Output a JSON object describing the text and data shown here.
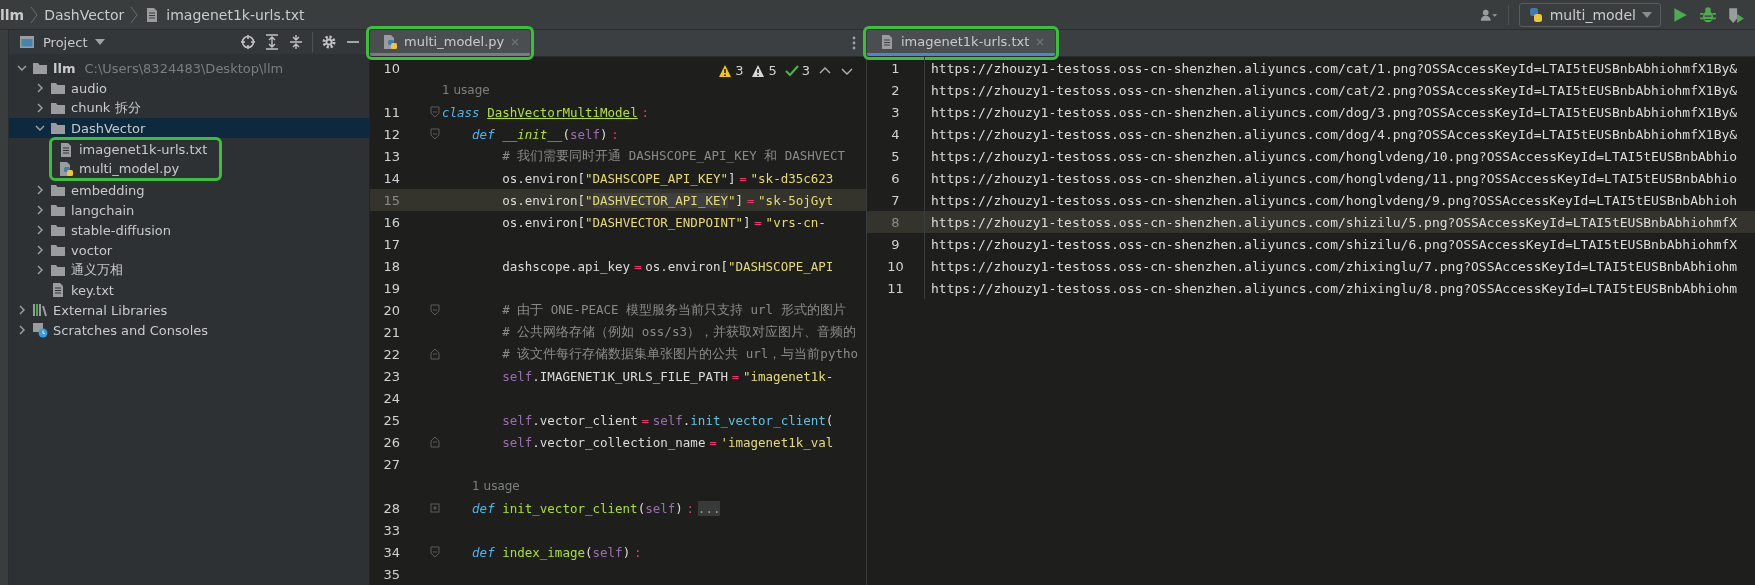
{
  "breadcrumbs": [
    {
      "label": "llm",
      "kind": "project"
    },
    {
      "label": "DashVector",
      "kind": "folder"
    },
    {
      "label": "imagenet1k-urls.txt",
      "kind": "text-file"
    }
  ],
  "toolbar": {
    "run_config": "multi_model"
  },
  "project_panel": {
    "title": "Project",
    "tree": [
      {
        "label": "llm",
        "kind": "project",
        "path": "C:\\Users\\8324483\\Desktop\\llm",
        "expanded": true,
        "selected": false,
        "children": [
          {
            "label": "audio",
            "kind": "folder",
            "expanded": false,
            "selected": false
          },
          {
            "label": "chunk 拆分",
            "kind": "folder",
            "expanded": false,
            "selected": false
          },
          {
            "label": "DashVector",
            "kind": "folder",
            "expanded": true,
            "selected": true,
            "children_annotated": true,
            "children": [
              {
                "label": "imagenet1k-urls.txt",
                "kind": "text-file",
                "selected": false
              },
              {
                "label": "multi_model.py",
                "kind": "python-file",
                "selected": false
              }
            ]
          },
          {
            "label": "embedding",
            "kind": "folder",
            "expanded": false,
            "selected": false
          },
          {
            "label": "langchain",
            "kind": "folder",
            "expanded": false,
            "selected": false
          },
          {
            "label": "stable-diffusion",
            "kind": "folder",
            "expanded": false,
            "selected": false
          },
          {
            "label": "voctor",
            "kind": "folder",
            "expanded": false,
            "selected": false
          },
          {
            "label": "通义万相",
            "kind": "folder",
            "expanded": false,
            "selected": false
          },
          {
            "label": "key.txt",
            "kind": "text-file",
            "selected": false
          }
        ]
      },
      {
        "label": "External Libraries",
        "kind": "libraries",
        "expanded": false,
        "selected": false
      },
      {
        "label": "Scratches and Consoles",
        "kind": "scratches",
        "expanded": false,
        "selected": false
      }
    ]
  },
  "code_editor": {
    "tab": {
      "label": "multi_model.py",
      "kind": "python-file",
      "focused": false,
      "annotated": true
    },
    "inspections": [
      {
        "kind": "warning",
        "count": "3"
      },
      {
        "kind": "weak-warning",
        "count": "5"
      },
      {
        "kind": "typo",
        "count": "3"
      }
    ],
    "lines": [
      {
        "kind": "code",
        "number": "10",
        "current": false
      },
      {
        "kind": "hint",
        "text": "1 usage"
      },
      {
        "kind": "code",
        "number": "11",
        "current": false,
        "collapsed": false,
        "tokens": [
          {
            "kind": "keyword",
            "text": "class"
          },
          {
            "kind": "classname",
            "text": "DashVectorMultiModel"
          },
          {
            "kind": "op",
            "text": ":"
          }
        ],
        "children": [
          {
            "kind": "code",
            "number": "12",
            "current": false,
            "collapsed": false,
            "tokens": [
              {
                "kind": "keyword",
                "text": "def"
              },
              {
                "kind": "magic",
                "text": "__init__"
              },
              {
                "kind": "plain",
                "text": "("
              },
              {
                "kind": "self",
                "text": "self"
              },
              {
                "kind": "plain",
                "text": ")"
              },
              {
                "kind": "op",
                "text": ":"
              }
            ],
            "children": [
              {
                "kind": "code",
                "number": "13",
                "current": false,
                "tokens": [
                  {
                    "kind": "comment",
                    "text": "# 我们需要同时开通 DASHSCOPE_API_KEY 和 DASHVECT"
                  }
                ]
              },
              {
                "kind": "code",
                "number": "14",
                "current": false,
                "tokens": [
                  {
                    "kind": "plain",
                    "text": "os.environ["
                  },
                  {
                    "kind": "string",
                    "text": "\"DASHSCOPE_API_KEY\""
                  },
                  {
                    "kind": "plain",
                    "text": "]"
                  },
                  {
                    "kind": "op",
                    "text": "="
                  },
                  {
                    "kind": "string",
                    "text": "\"sk-d35c623"
                  }
                ]
              },
              {
                "kind": "code",
                "number": "15",
                "current": true,
                "tokens": [
                  {
                    "kind": "plain",
                    "text": "os.environ["
                  },
                  {
                    "kind": "string",
                    "text": "\""
                  },
                  {
                    "kind": "match",
                    "text": "DASHVECTOR_API_KEY"
                  },
                  {
                    "kind": "string",
                    "text": "\""
                  },
                  {
                    "kind": "plain",
                    "text": "]"
                  },
                  {
                    "kind": "op",
                    "text": "="
                  },
                  {
                    "kind": "string",
                    "text": "\"sk-5ojGyt"
                  }
                ]
              },
              {
                "kind": "code",
                "number": "16",
                "current": false,
                "tokens": [
                  {
                    "kind": "plain",
                    "text": "os.environ["
                  },
                  {
                    "kind": "string",
                    "text": "\"DASHVECTOR_ENDPOINT\""
                  },
                  {
                    "kind": "plain",
                    "text": "]"
                  },
                  {
                    "kind": "op",
                    "text": "="
                  },
                  {
                    "kind": "string",
                    "text": "\"vrs-cn-"
                  }
                ]
              },
              {
                "kind": "code",
                "number": "17",
                "current": false
              },
              {
                "kind": "code",
                "number": "18",
                "current": false,
                "tokens": [
                  {
                    "kind": "plain",
                    "text": "dashscope.api_key"
                  },
                  {
                    "kind": "op",
                    "text": "="
                  },
                  {
                    "kind": "plain",
                    "text": "os.environ["
                  },
                  {
                    "kind": "string",
                    "text": "\"DASHSCOPE_API"
                  }
                ]
              },
              {
                "kind": "code",
                "number": "19",
                "current": false
              },
              {
                "kind": "code",
                "number": "20",
                "current": false,
                "collapsed": false,
                "tokens": [
                  {
                    "kind": "comment",
                    "text": "# 由于 ONE-PEACE 模型服务当前只支持 url 形式的图片"
                  }
                ]
              },
              {
                "kind": "code",
                "number": "21",
                "current": false,
                "tokens": [
                  {
                    "kind": "comment",
                    "text": "# 公共网络存储（例如 oss/s3），并获取对应图片、音频的"
                  }
                ]
              },
              {
                "kind": "code",
                "number": "22",
                "current": false,
                "fold_end": true,
                "tokens": [
                  {
                    "kind": "comment",
                    "text": "# 该文件每行存储数据集单张图片的公共 url，与当前pytho"
                  }
                ]
              },
              {
                "kind": "code",
                "number": "23",
                "current": false,
                "tokens": [
                  {
                    "kind": "self",
                    "text": "self"
                  },
                  {
                    "kind": "plain",
                    "text": ".IMAGENET1K_URLS_FILE_PATH"
                  },
                  {
                    "kind": "op",
                    "text": "="
                  },
                  {
                    "kind": "string",
                    "text": "\"imagenet1k-"
                  }
                ]
              },
              {
                "kind": "code",
                "number": "24",
                "current": false
              },
              {
                "kind": "code",
                "number": "25",
                "current": false,
                "tokens": [
                  {
                    "kind": "self",
                    "text": "self"
                  },
                  {
                    "kind": "plain",
                    "text": ".vector_client"
                  },
                  {
                    "kind": "op",
                    "text": "="
                  },
                  {
                    "kind": "self",
                    "text": "self"
                  },
                  {
                    "kind": "plain",
                    "text": "."
                  },
                  {
                    "kind": "call",
                    "text": "init_vector_client"
                  },
                  {
                    "kind": "plain",
                    "text": "("
                  }
                ]
              },
              {
                "kind": "code",
                "number": "26",
                "current": false,
                "fold_end": true,
                "tokens": [
                  {
                    "kind": "self",
                    "text": "self"
                  },
                  {
                    "kind": "plain",
                    "text": ".vector_collection_name"
                  },
                  {
                    "kind": "op",
                    "text": "="
                  },
                  {
                    "kind": "string",
                    "text": "'imagenet1k_val"
                  }
                ]
              }
            ]
          },
          {
            "kind": "code",
            "number": "27",
            "current": false
          },
          {
            "kind": "hint",
            "text": "1 usage"
          },
          {
            "kind": "code",
            "number": "28",
            "current": false,
            "collapsed": true,
            "tokens": [
              {
                "kind": "keyword",
                "text": "def"
              },
              {
                "kind": "func",
                "text": "init_vector_client"
              },
              {
                "kind": "plain",
                "text": "("
              },
              {
                "kind": "self",
                "text": "self"
              },
              {
                "kind": "plain",
                "text": ")"
              },
              {
                "kind": "op",
                "text": ":"
              },
              {
                "kind": "folded",
                "text": "..."
              }
            ]
          },
          {
            "kind": "code",
            "number": "33",
            "current": false
          },
          {
            "kind": "code",
            "number": "34",
            "current": false,
            "collapsed": false,
            "tokens": [
              {
                "kind": "keyword",
                "text": "def"
              },
              {
                "kind": "func",
                "text": "index_image"
              },
              {
                "kind": "plain",
                "text": "("
              },
              {
                "kind": "self",
                "text": "self"
              },
              {
                "kind": "plain",
                "text": ")"
              },
              {
                "kind": "op",
                "text": ":"
              }
            ],
            "children": [
              {
                "kind": "code",
                "number": "35",
                "current": false
              }
            ]
          }
        ]
      }
    ]
  },
  "text_editor": {
    "tab": {
      "label": "imagenet1k-urls.txt",
      "kind": "text-file",
      "focused": true,
      "annotated": true
    },
    "lines": [
      {
        "number": "1",
        "current": false,
        "text": "https://zhouzy1-testoss.oss-cn-shenzhen.aliyuncs.com/cat/1.png?OSSAccessKeyId=LTAI5tEUSBnbAbhiohmfX1By&"
      },
      {
        "number": "2",
        "current": false,
        "text": "https://zhouzy1-testoss.oss-cn-shenzhen.aliyuncs.com/cat/2.png?OSSAccessKeyId=LTAI5tEUSBnbAbhiohmfX1By&"
      },
      {
        "number": "3",
        "current": false,
        "text": "https://zhouzy1-testoss.oss-cn-shenzhen.aliyuncs.com/dog/3.png?OSSAccessKeyId=LTAI5tEUSBnbAbhiohmfX1By&"
      },
      {
        "number": "4",
        "current": false,
        "text": "https://zhouzy1-testoss.oss-cn-shenzhen.aliyuncs.com/dog/4.png?OSSAccessKeyId=LTAI5tEUSBnbAbhiohmfX1By&"
      },
      {
        "number": "5",
        "current": false,
        "text": "https://zhouzy1-testoss.oss-cn-shenzhen.aliyuncs.com/honglvdeng/10.png?OSSAccessKeyId=LTAI5tEUSBnbAbhio"
      },
      {
        "number": "6",
        "current": false,
        "text": "https://zhouzy1-testoss.oss-cn-shenzhen.aliyuncs.com/honglvdeng/11.png?OSSAccessKeyId=LTAI5tEUSBnbAbhio"
      },
      {
        "number": "7",
        "current": false,
        "text": "https://zhouzy1-testoss.oss-cn-shenzhen.aliyuncs.com/honglvdeng/9.png?OSSAccessKeyId=LTAI5tEUSBnbAbhioh"
      },
      {
        "number": "8",
        "current": true,
        "text": "https://zhouzy1-testoss.oss-cn-shenzhen.aliyuncs.com/shizilu/5.png?OSSAccessKeyId=LTAI5tEUSBnbAbhiohmfX"
      },
      {
        "number": "9",
        "current": false,
        "text": "https://zhouzy1-testoss.oss-cn-shenzhen.aliyuncs.com/shizilu/6.png?OSSAccessKeyId=LTAI5tEUSBnbAbhiohmfX"
      },
      {
        "number": "10",
        "current": false,
        "text": "https://zhouzy1-testoss.oss-cn-shenzhen.aliyuncs.com/zhixinglu/7.png?OSSAccessKeyId=LTAI5tEUSBnbAbhiohm"
      },
      {
        "number": "11",
        "current": false,
        "text": "https://zhouzy1-testoss.oss-cn-shenzhen.aliyuncs.com/zhixinglu/8.png?OSSAccessKeyId=LTAI5tEUSBnbAbhiohm"
      }
    ]
  }
}
